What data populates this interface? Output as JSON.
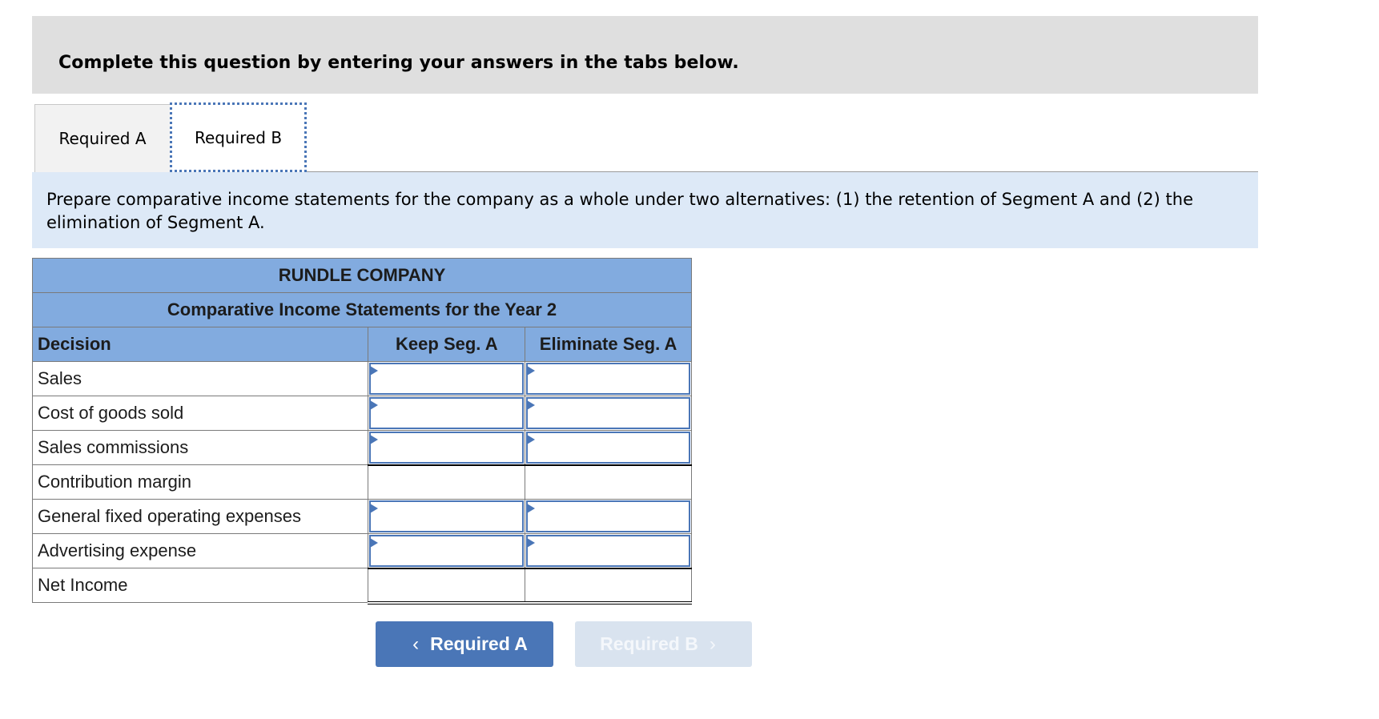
{
  "header": {
    "title": "Complete this question by entering your answers in the tabs below."
  },
  "tabs": [
    {
      "label": "Required A",
      "active": false
    },
    {
      "label": "Required B",
      "active": true
    }
  ],
  "prompt": "Prepare comparative income statements for the company as a whole under two alternatives: (1) the retention of Segment A and (2) the elimination of Segment A.",
  "statement": {
    "company": "RUNDLE COMPANY",
    "title": "Comparative Income Statements for the Year 2",
    "column_headers": [
      "Decision",
      "Keep Seg. A",
      "Eliminate Seg. A"
    ],
    "rows": [
      {
        "label": "Sales",
        "keep": "",
        "eliminate": "",
        "editable": true
      },
      {
        "label": "Cost of goods sold",
        "keep": "",
        "eliminate": "",
        "editable": true
      },
      {
        "label": "Sales commissions",
        "keep": "",
        "eliminate": "",
        "editable": true
      },
      {
        "label": "Contribution margin",
        "keep": "",
        "eliminate": "",
        "editable": false
      },
      {
        "label": "General fixed operating expenses",
        "keep": "",
        "eliminate": "",
        "editable": true
      },
      {
        "label": "Advertising expense",
        "keep": "",
        "eliminate": "",
        "editable": true
      },
      {
        "label": "Net Income",
        "keep": "",
        "eliminate": "",
        "editable": false
      }
    ]
  },
  "navigation": {
    "prev_label": "Required A",
    "prev_icon": "chevron-left-icon",
    "next_label": "Required B",
    "next_icon": "chevron-right-icon",
    "next_disabled": true
  },
  "colors": {
    "accent": "#4a76b7",
    "table_header": "#82abdf",
    "prompt_bg": "#dde9f7",
    "header_bg": "#dfdfdf"
  }
}
